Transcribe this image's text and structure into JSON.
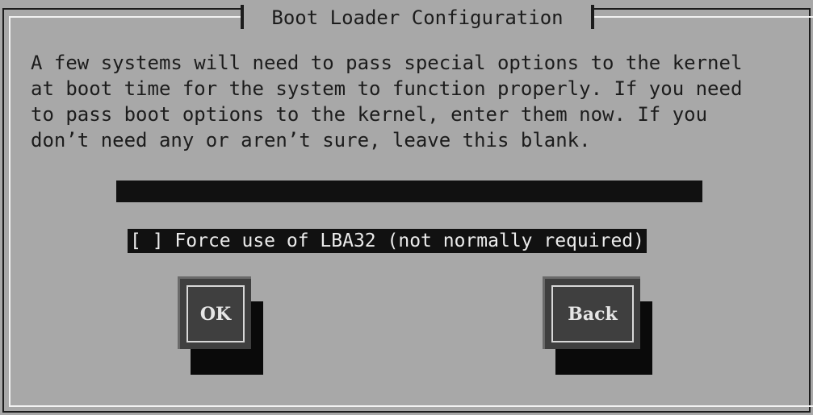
{
  "dialog": {
    "title": "Boot Loader Configuration",
    "description": "A few systems will need to pass special options to the kernel\nat boot time for the system to function properly. If you need\nto pass boot options to the kernel, enter them now. If you\ndon’t need any or aren’t sure, leave this blank.",
    "kernel_options_value": "",
    "checkbox": {
      "mark": "[ ]",
      "label": "Force use of LBA32 (not normally required)",
      "checked": false
    },
    "buttons": {
      "ok_label": "OK",
      "back_label": "Back"
    }
  },
  "colors": {
    "dialog_background": "#a8a8a8",
    "field_background": "#111111",
    "button_face": "#3f3f3f",
    "text": "#1c1c1c"
  }
}
